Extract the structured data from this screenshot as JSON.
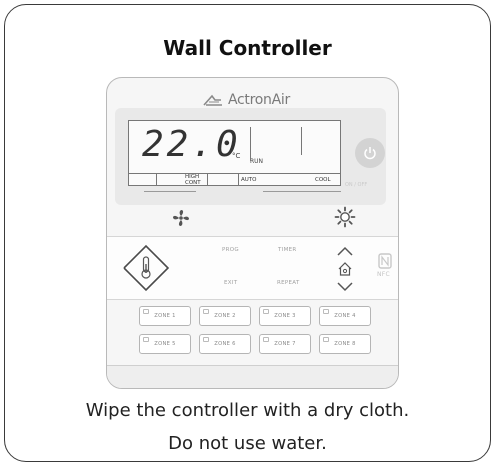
{
  "title": "Wall Controller",
  "instructions": [
    "Wipe the controller with a dry cloth.",
    "Do not use water."
  ],
  "device": {
    "brand": "ActronAir",
    "display": {
      "temperature": "22.0",
      "unit": "°C",
      "run_label": "RUN",
      "mode_labels": {
        "high_cont": "HIGH CONT",
        "auto": "AUTO",
        "cool": "COOL"
      }
    },
    "power_label": "ON / OFF",
    "buttons": {
      "prog": "PROG",
      "timer": "TIMER",
      "exit": "EXIT",
      "repeat": "REPEAT"
    },
    "nfc_label": "NFC",
    "zones": [
      "ZONE 1",
      "ZONE 2",
      "ZONE 3",
      "ZONE 4",
      "ZONE 5",
      "ZONE 6",
      "ZONE 7",
      "ZONE 8"
    ]
  },
  "icons": {
    "power": "power-icon",
    "fan": "fan-icon",
    "sun": "sun-icon",
    "temp_up_down": "temperature-rocker-icon",
    "home": "home-icon",
    "nfc": "nfc-icon"
  },
  "colors": {
    "border": "#3a3a3a",
    "device_outline": "#b9b9b9",
    "lcd_outline": "#777777",
    "power_button": "#d3d3d3"
  }
}
